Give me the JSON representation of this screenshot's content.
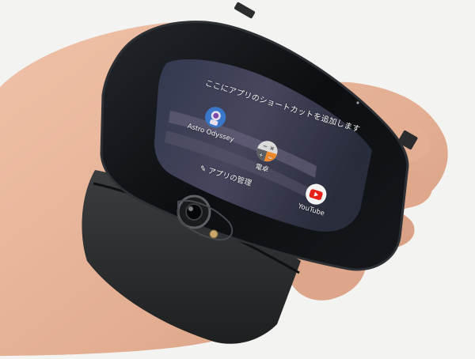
{
  "cover_screen": {
    "prompt": "ここにアプリのショートカットを追加します",
    "apps": [
      {
        "label": "Astro Odyssey",
        "icon": "astronaut-icon"
      },
      {
        "label": "電卓",
        "icon": "calculator-icon"
      },
      {
        "label": "YouTube",
        "icon": "youtube-icon"
      }
    ],
    "manage_label": "アプリの管理",
    "manage_icon": "pencil-icon"
  },
  "colors": {
    "background": "#f3f3f1",
    "skin": "#e8b59b",
    "phone_body": "#2b2d2e",
    "screen_glass": "#0d1014",
    "youtube_red": "#e62117"
  }
}
